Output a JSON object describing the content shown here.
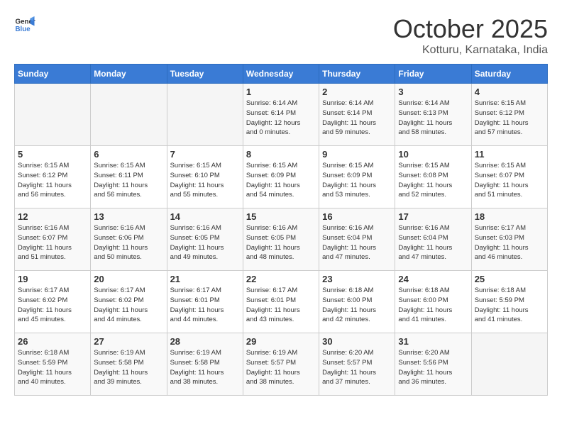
{
  "header": {
    "logo_general": "General",
    "logo_blue": "Blue",
    "title": "October 2025",
    "subtitle": "Kotturu, Karnataka, India"
  },
  "weekdays": [
    "Sunday",
    "Monday",
    "Tuesday",
    "Wednesday",
    "Thursday",
    "Friday",
    "Saturday"
  ],
  "weeks": [
    [
      {
        "day": "",
        "info": ""
      },
      {
        "day": "",
        "info": ""
      },
      {
        "day": "",
        "info": ""
      },
      {
        "day": "1",
        "info": "Sunrise: 6:14 AM\nSunset: 6:14 PM\nDaylight: 12 hours\nand 0 minutes."
      },
      {
        "day": "2",
        "info": "Sunrise: 6:14 AM\nSunset: 6:14 PM\nDaylight: 11 hours\nand 59 minutes."
      },
      {
        "day": "3",
        "info": "Sunrise: 6:14 AM\nSunset: 6:13 PM\nDaylight: 11 hours\nand 58 minutes."
      },
      {
        "day": "4",
        "info": "Sunrise: 6:15 AM\nSunset: 6:12 PM\nDaylight: 11 hours\nand 57 minutes."
      }
    ],
    [
      {
        "day": "5",
        "info": "Sunrise: 6:15 AM\nSunset: 6:12 PM\nDaylight: 11 hours\nand 56 minutes."
      },
      {
        "day": "6",
        "info": "Sunrise: 6:15 AM\nSunset: 6:11 PM\nDaylight: 11 hours\nand 56 minutes."
      },
      {
        "day": "7",
        "info": "Sunrise: 6:15 AM\nSunset: 6:10 PM\nDaylight: 11 hours\nand 55 minutes."
      },
      {
        "day": "8",
        "info": "Sunrise: 6:15 AM\nSunset: 6:09 PM\nDaylight: 11 hours\nand 54 minutes."
      },
      {
        "day": "9",
        "info": "Sunrise: 6:15 AM\nSunset: 6:09 PM\nDaylight: 11 hours\nand 53 minutes."
      },
      {
        "day": "10",
        "info": "Sunrise: 6:15 AM\nSunset: 6:08 PM\nDaylight: 11 hours\nand 52 minutes."
      },
      {
        "day": "11",
        "info": "Sunrise: 6:15 AM\nSunset: 6:07 PM\nDaylight: 11 hours\nand 51 minutes."
      }
    ],
    [
      {
        "day": "12",
        "info": "Sunrise: 6:16 AM\nSunset: 6:07 PM\nDaylight: 11 hours\nand 51 minutes."
      },
      {
        "day": "13",
        "info": "Sunrise: 6:16 AM\nSunset: 6:06 PM\nDaylight: 11 hours\nand 50 minutes."
      },
      {
        "day": "14",
        "info": "Sunrise: 6:16 AM\nSunset: 6:05 PM\nDaylight: 11 hours\nand 49 minutes."
      },
      {
        "day": "15",
        "info": "Sunrise: 6:16 AM\nSunset: 6:05 PM\nDaylight: 11 hours\nand 48 minutes."
      },
      {
        "day": "16",
        "info": "Sunrise: 6:16 AM\nSunset: 6:04 PM\nDaylight: 11 hours\nand 47 minutes."
      },
      {
        "day": "17",
        "info": "Sunrise: 6:16 AM\nSunset: 6:04 PM\nDaylight: 11 hours\nand 47 minutes."
      },
      {
        "day": "18",
        "info": "Sunrise: 6:17 AM\nSunset: 6:03 PM\nDaylight: 11 hours\nand 46 minutes."
      }
    ],
    [
      {
        "day": "19",
        "info": "Sunrise: 6:17 AM\nSunset: 6:02 PM\nDaylight: 11 hours\nand 45 minutes."
      },
      {
        "day": "20",
        "info": "Sunrise: 6:17 AM\nSunset: 6:02 PM\nDaylight: 11 hours\nand 44 minutes."
      },
      {
        "day": "21",
        "info": "Sunrise: 6:17 AM\nSunset: 6:01 PM\nDaylight: 11 hours\nand 44 minutes."
      },
      {
        "day": "22",
        "info": "Sunrise: 6:17 AM\nSunset: 6:01 PM\nDaylight: 11 hours\nand 43 minutes."
      },
      {
        "day": "23",
        "info": "Sunrise: 6:18 AM\nSunset: 6:00 PM\nDaylight: 11 hours\nand 42 minutes."
      },
      {
        "day": "24",
        "info": "Sunrise: 6:18 AM\nSunset: 6:00 PM\nDaylight: 11 hours\nand 41 minutes."
      },
      {
        "day": "25",
        "info": "Sunrise: 6:18 AM\nSunset: 5:59 PM\nDaylight: 11 hours\nand 41 minutes."
      }
    ],
    [
      {
        "day": "26",
        "info": "Sunrise: 6:18 AM\nSunset: 5:59 PM\nDaylight: 11 hours\nand 40 minutes."
      },
      {
        "day": "27",
        "info": "Sunrise: 6:19 AM\nSunset: 5:58 PM\nDaylight: 11 hours\nand 39 minutes."
      },
      {
        "day": "28",
        "info": "Sunrise: 6:19 AM\nSunset: 5:58 PM\nDaylight: 11 hours\nand 38 minutes."
      },
      {
        "day": "29",
        "info": "Sunrise: 6:19 AM\nSunset: 5:57 PM\nDaylight: 11 hours\nand 38 minutes."
      },
      {
        "day": "30",
        "info": "Sunrise: 6:20 AM\nSunset: 5:57 PM\nDaylight: 11 hours\nand 37 minutes."
      },
      {
        "day": "31",
        "info": "Sunrise: 6:20 AM\nSunset: 5:56 PM\nDaylight: 11 hours\nand 36 minutes."
      },
      {
        "day": "",
        "info": ""
      }
    ]
  ]
}
